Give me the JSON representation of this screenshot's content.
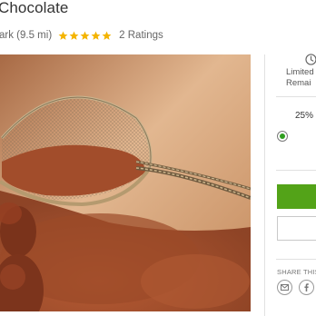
{
  "deal": {
    "title": "Chocolate",
    "location": "ark (9.5 mi)",
    "rating_value": 5,
    "rating_max": 5,
    "ratings_count_label": "2 Ratings"
  },
  "sidebar": {
    "limited_line1": "Limited",
    "limited_line2": "Remai",
    "discount": "25%",
    "option_selected": true,
    "share_label": "SHARE THIS"
  },
  "colors": {
    "star": "#f4b400",
    "accent_green": "#53a318",
    "radio_green": "#2f9e1f"
  },
  "icons": {
    "limited": "clock-icon",
    "share_email": "envelope-icon",
    "share_facebook": "facebook-icon"
  },
  "photo": {
    "subject": "cocoa powder in a metal sieve on wooden table"
  }
}
